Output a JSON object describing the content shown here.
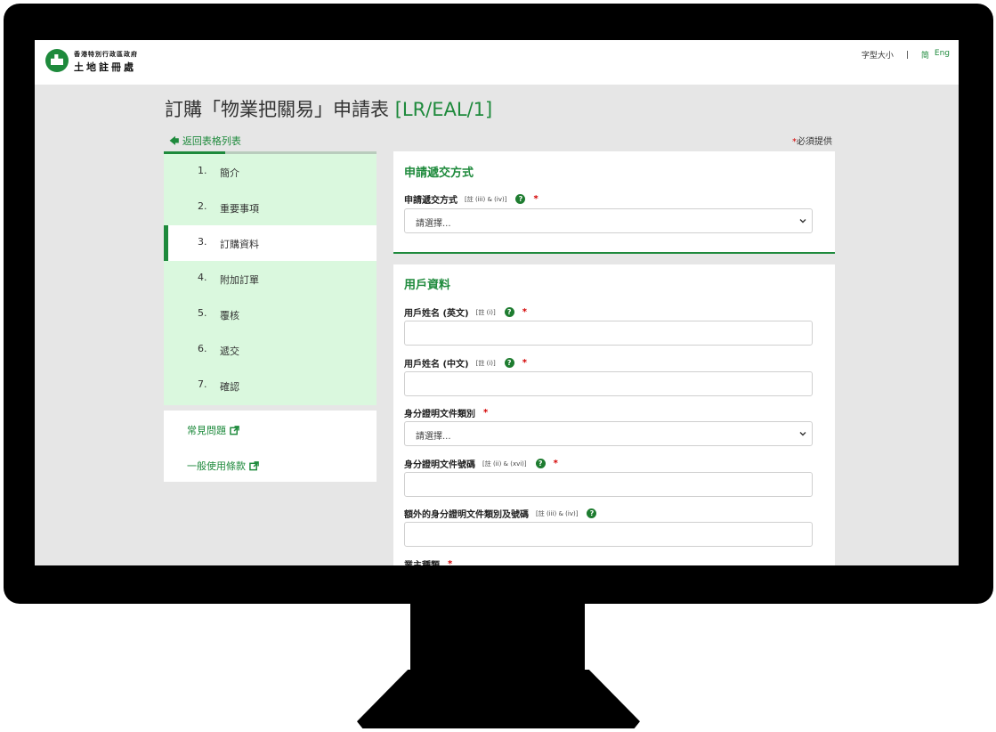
{
  "header": {
    "dept_sub": "香港特別行政區政府",
    "dept_name": "土地註冊處",
    "font_size_label": "字型大小",
    "divider": "|",
    "lang_simplified": "简",
    "lang_english": "Eng"
  },
  "page": {
    "title": "訂購「物業把關易」申請表",
    "form_code": "[LR/EAL/1]",
    "back_link": "返回表格列表",
    "required_star": "*",
    "required_text": "必須提供"
  },
  "steps": [
    {
      "num": "1.",
      "label": "簡介"
    },
    {
      "num": "2.",
      "label": "重要事項"
    },
    {
      "num": "3.",
      "label": "訂購資料"
    },
    {
      "num": "4.",
      "label": "附加訂單"
    },
    {
      "num": "5.",
      "label": "覆核"
    },
    {
      "num": "6.",
      "label": "遞交"
    },
    {
      "num": "7.",
      "label": "確認"
    }
  ],
  "help_links": [
    {
      "label": "常見問題",
      "icon": "external-link-icon"
    },
    {
      "label": "一般使用條款",
      "icon": "external-link-icon"
    }
  ],
  "section1": {
    "title": "申請遞交方式",
    "field_label": "申請遞交方式",
    "field_note": "[註 (iii) & (iv)]",
    "select_value": "請選擇..."
  },
  "section2": {
    "title": "用戶資料",
    "fields": [
      {
        "label": "用戶姓名 (英文)",
        "note": "[註 (i)]",
        "value": ""
      },
      {
        "label": "用戶姓名 (中文)",
        "note": "[註 (i)]",
        "value": ""
      },
      {
        "label": "身分證明文件類別",
        "note": "",
        "value": "請選擇..."
      },
      {
        "label": "身分證明文件號碼",
        "note": "[註 (ii) & (xvi)]",
        "value": ""
      },
      {
        "label": "額外的身分證明文件類別及號碼",
        "note": "[註 (iii) & (iv)]",
        "value": ""
      },
      {
        "label": "業主種類",
        "note": "",
        "value": ""
      }
    ]
  },
  "colors": {
    "brand_green": "#1e8a3c",
    "step_bg": "#daf8de",
    "required_red": "#d40000"
  }
}
